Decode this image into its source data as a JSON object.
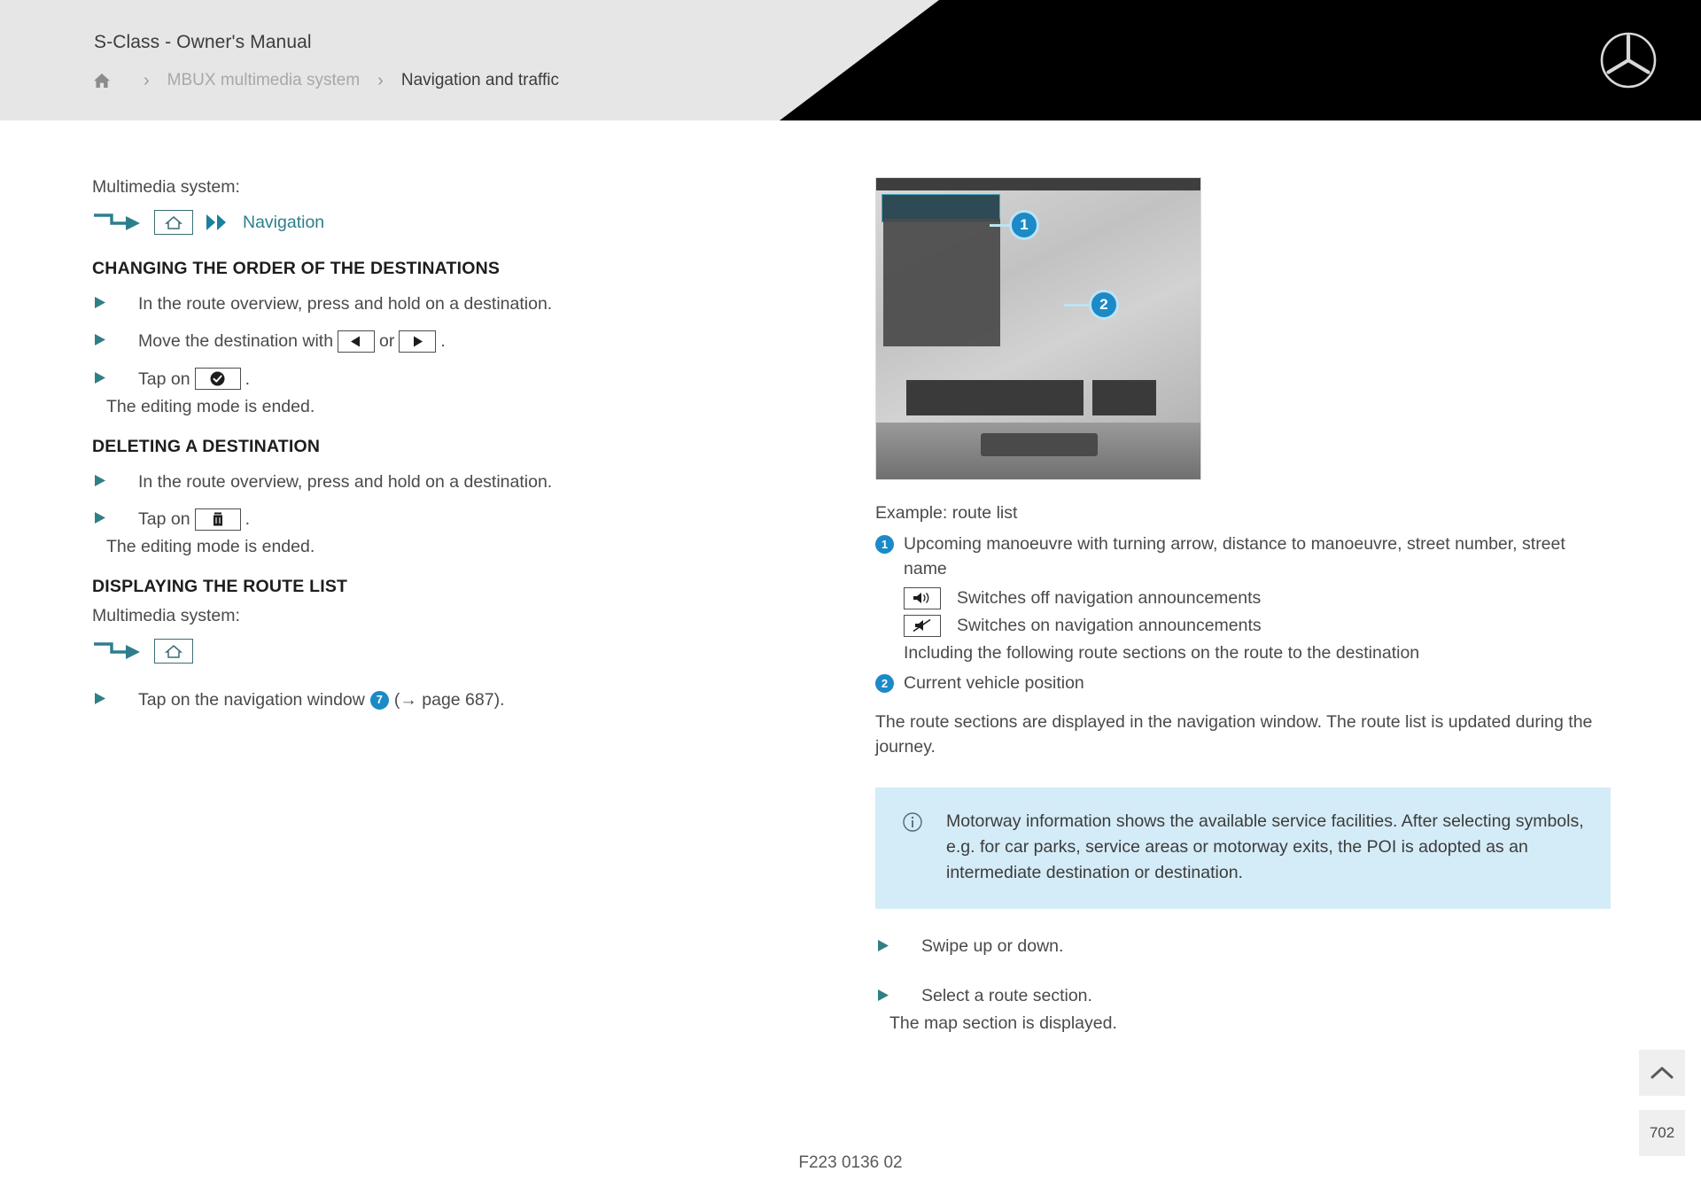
{
  "header": {
    "title": "S-Class - Owner's Manual",
    "breadcrumb": {
      "home_icon": "home-icon",
      "separator": "›",
      "items": [
        {
          "label": "MBUX multimedia system",
          "active": false
        },
        {
          "label": "Navigation and traffic",
          "active": true
        }
      ]
    },
    "brand_logo": "mercedes-star-icon"
  },
  "left": {
    "lead_1": "Multimedia system:",
    "path_1": {
      "arrow_icon": "path-arrow-icon",
      "home_box_icon": "home-box-icon",
      "chevron_icon": "double-chevron-icon",
      "label": "Navigation"
    },
    "section_1": {
      "heading": "CHANGING THE ORDER OF THE DESTINATIONS",
      "bullets": [
        {
          "text": "In the route overview, press and hold on a destination."
        },
        {
          "text_before": "Move the destination with ",
          "key_a": "left-arrow-icon",
          "text_mid": " or ",
          "key_b": "right-arrow-icon",
          "text_after": "."
        },
        {
          "text_before": "Tap on ",
          "key_a": "checkmark-icon",
          "text_after": ".",
          "subline": "The editing mode is ended."
        }
      ]
    },
    "section_2": {
      "heading": "DELETING A DESTINATION",
      "bullets": [
        {
          "text": "In the route overview, press and hold on a destination."
        },
        {
          "text_before": "Tap on ",
          "key_a": "trash-icon",
          "text_after": ".",
          "subline": "The editing mode is ended."
        }
      ]
    },
    "section_3": {
      "heading": "DISPLAYING THE ROUTE LIST",
      "lead": "Multimedia system:",
      "path": {
        "arrow_icon": "path-arrow-icon",
        "home_box_icon": "home-box-icon"
      },
      "bullet": {
        "text_before": "Tap on the navigation window ",
        "badge": "7",
        "text_after": "(→ page 687)."
      }
    }
  },
  "right": {
    "figure": {
      "alt": "MBUX navigation screen showing route list",
      "callouts": [
        {
          "number": "1"
        },
        {
          "number": "2"
        }
      ]
    },
    "caption": "Example: route list",
    "legend": [
      {
        "badge": "1",
        "text": "Upcoming manoeuvre with turning arrow, distance to manoeuvre, street number, street name",
        "sub_items": [
          {
            "icon": "speaker-on-icon",
            "text": "Switches off navigation announcements"
          },
          {
            "icon": "speaker-muted-icon",
            "text": "Switches on navigation announcements"
          }
        ],
        "plain": "Including the following route sections on the route to the destination"
      },
      {
        "badge": "2",
        "text": "Current vehicle position"
      }
    ],
    "paragraph": "The route sections are displayed in the navigation window. The route list is updated during the journey.",
    "note": {
      "icon": "info-icon",
      "text": "Motorway information shows the available service facilities. After selecting symbols, e.g. for car parks, service areas or motorway exits, the POI is adopted as an intermediate destination or destination."
    },
    "bullets": [
      {
        "text": "Swipe up or down."
      },
      {
        "text": "Select a route section.",
        "subline": "The map section is displayed."
      }
    ]
  },
  "floating": {
    "scroll_top_icon": "chevron-up-icon",
    "page_number": "702"
  },
  "footer": {
    "code": "F223 0136 02"
  },
  "colors": {
    "accent_teal": "#2c7e8c",
    "badge_blue": "#1b8ac7",
    "note_bg": "#d4ecf7",
    "header_bg": "#e6e6e6"
  }
}
